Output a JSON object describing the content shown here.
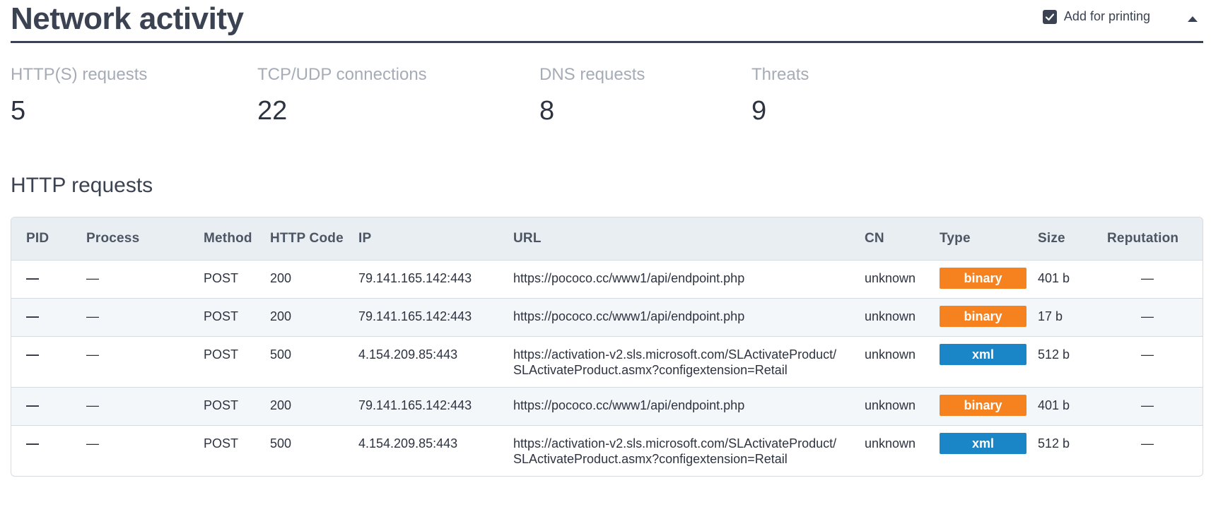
{
  "header": {
    "title": "Network activity",
    "print_label": "Add for printing"
  },
  "stats": [
    {
      "label": "HTTP(S) requests",
      "value": "5"
    },
    {
      "label": "TCP/UDP connections",
      "value": "22"
    },
    {
      "label": "DNS requests",
      "value": "8"
    },
    {
      "label": "Threats",
      "value": "9"
    }
  ],
  "section": {
    "title": "HTTP requests"
  },
  "table": {
    "headers": [
      "PID",
      "Process",
      "Method",
      "HTTP Code",
      "IP",
      "URL",
      "CN",
      "Type",
      "Size",
      "Reputation"
    ],
    "rows": [
      {
        "pid": "—",
        "process": "—",
        "method": "POST",
        "code": "200",
        "ip": "79.141.165.142:443",
        "url": "https://pococo.cc/www1/api/endpoint.php",
        "cn": "unknown",
        "type": "binary",
        "size": "401 b",
        "reputation": "—"
      },
      {
        "pid": "—",
        "process": "—",
        "method": "POST",
        "code": "200",
        "ip": "79.141.165.142:443",
        "url": "https://pococo.cc/www1/api/endpoint.php",
        "cn": "unknown",
        "type": "binary",
        "size": "17 b",
        "reputation": "—"
      },
      {
        "pid": "—",
        "process": "—",
        "method": "POST",
        "code": "500",
        "ip": "4.154.209.85:443",
        "url": "https://activation-v2.sls.microsoft.com/SLActivateProduct/SLActivateProduct.asmx?configextension=Retail",
        "cn": "unknown",
        "type": "xml",
        "size": "512 b",
        "reputation": "—"
      },
      {
        "pid": "—",
        "process": "—",
        "method": "POST",
        "code": "200",
        "ip": "79.141.165.142:443",
        "url": "https://pococo.cc/www1/api/endpoint.php",
        "cn": "unknown",
        "type": "binary",
        "size": "401 b",
        "reputation": "—"
      },
      {
        "pid": "—",
        "process": "—",
        "method": "POST",
        "code": "500",
        "ip": "4.154.209.85:443",
        "url": "https://activation-v2.sls.microsoft.com/SLActivateProduct/SLActivateProduct.asmx?configextension=Retail",
        "cn": "unknown",
        "type": "xml",
        "size": "512 b",
        "reputation": "—"
      }
    ]
  },
  "colors": {
    "binary": "#f5821f",
    "xml": "#1a86c8",
    "header_dark": "#3b4251"
  },
  "icons": {
    "checkbox": "checkbox-checked-icon",
    "collapse": "caret-up-icon"
  }
}
